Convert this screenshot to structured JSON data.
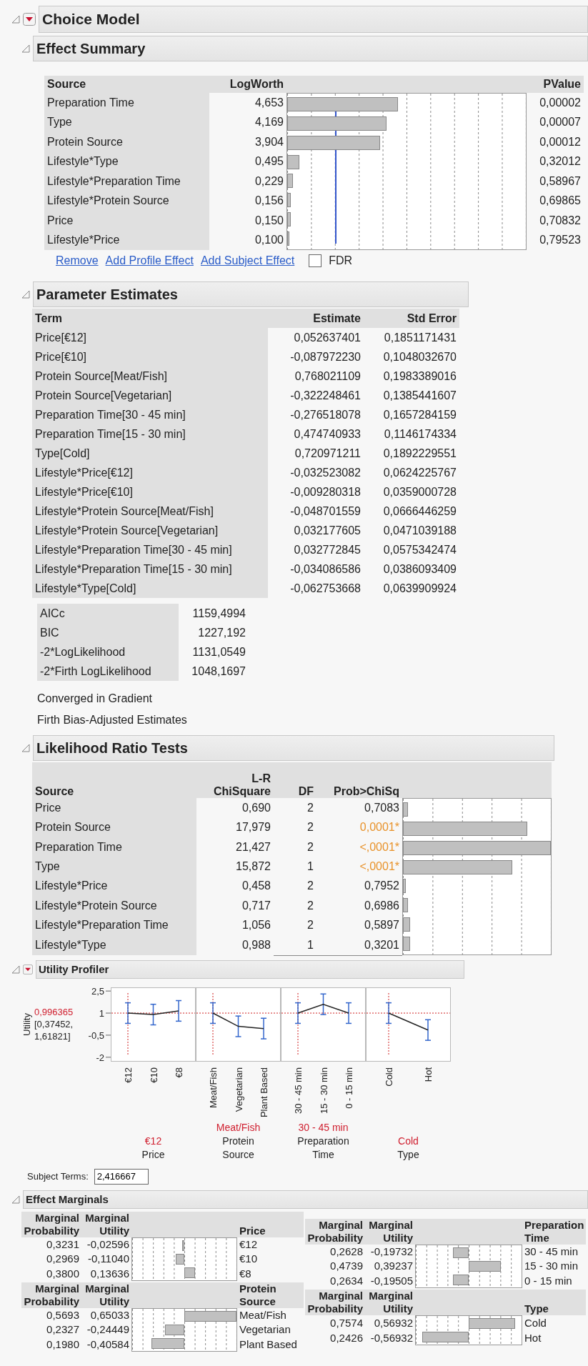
{
  "title": "Choice Model",
  "effect_summary": {
    "title": "Effect Summary",
    "columns": [
      "Source",
      "LogWorth",
      "PValue"
    ],
    "rows": [
      {
        "source": "Preparation Time",
        "logworth": "4,653",
        "pvalue": "0,00002"
      },
      {
        "source": "Type",
        "logworth": "4,169",
        "pvalue": "0,00007"
      },
      {
        "source": "Protein Source",
        "logworth": "3,904",
        "pvalue": "0,00012"
      },
      {
        "source": "Lifestyle*Type",
        "logworth": "0,495",
        "pvalue": "0,32012"
      },
      {
        "source": "Lifestyle*Preparation Time",
        "logworth": "0,229",
        "pvalue": "0,58967"
      },
      {
        "source": "Lifestyle*Protein Source",
        "logworth": "0,156",
        "pvalue": "0,69865"
      },
      {
        "source": "Price",
        "logworth": "0,150",
        "pvalue": "0,70832"
      },
      {
        "source": "Lifestyle*Price",
        "logworth": "0,100",
        "pvalue": "0,79523"
      }
    ],
    "links": [
      "Remove",
      "Add Profile Effect",
      "Add Subject Effect"
    ],
    "fdr": {
      "label": "FDR",
      "checked": false
    }
  },
  "parameter_estimates": {
    "title": "Parameter Estimates",
    "columns": [
      "Term",
      "Estimate",
      "Std Error"
    ],
    "rows": [
      {
        "term": "Price[€12]",
        "estimate": "0,052637401",
        "std_error": "0,1851171431"
      },
      {
        "term": "Price[€10]",
        "estimate": "-0,087972230",
        "std_error": "0,1048032670"
      },
      {
        "term": "Protein Source[Meat/Fish]",
        "estimate": "0,768021109",
        "std_error": "0,1983389016"
      },
      {
        "term": "Protein Source[Vegetarian]",
        "estimate": "-0,322248461",
        "std_error": "0,1385441607"
      },
      {
        "term": "Preparation Time[30 - 45 min]",
        "estimate": "-0,276518078",
        "std_error": "0,1657284159"
      },
      {
        "term": "Preparation Time[15 - 30 min]",
        "estimate": "0,474740933",
        "std_error": "0,1146174334"
      },
      {
        "term": "Type[Cold]",
        "estimate": "0,720971211",
        "std_error": "0,1892229551"
      },
      {
        "term": "Lifestyle*Price[€12]",
        "estimate": "-0,032523082",
        "std_error": "0,0624225767"
      },
      {
        "term": "Lifestyle*Price[€10]",
        "estimate": "-0,009280318",
        "std_error": "0,0359000728"
      },
      {
        "term": "Lifestyle*Protein Source[Meat/Fish]",
        "estimate": "-0,048701559",
        "std_error": "0,0666446259"
      },
      {
        "term": "Lifestyle*Protein Source[Vegetarian]",
        "estimate": "0,032177605",
        "std_error": "0,0471039188"
      },
      {
        "term": "Lifestyle*Preparation Time[30 - 45 min]",
        "estimate": "0,032772845",
        "std_error": "0,0575342474"
      },
      {
        "term": "Lifestyle*Preparation Time[15 - 30 min]",
        "estimate": "-0,034086586",
        "std_error": "0,0386093409"
      },
      {
        "term": "Lifestyle*Type[Cold]",
        "estimate": "-0,062753668",
        "std_error": "0,0639909924"
      }
    ],
    "fit_stats": [
      {
        "label": "AICc",
        "value": "1159,4994"
      },
      {
        "label": "BIC",
        "value": "1227,192"
      },
      {
        "label": "-2*LogLikelihood",
        "value": "1131,0549"
      },
      {
        "label": "-2*Firth LogLikelihood",
        "value": "1048,1697"
      }
    ],
    "notes": [
      "Converged in Gradient",
      "Firth Bias-Adjusted Estimates"
    ]
  },
  "likelihood_ratio_tests": {
    "title": "Likelihood Ratio Tests",
    "columns": [
      "Source",
      "L-R ChiSquare",
      "DF",
      "Prob>ChiSq"
    ],
    "rows": [
      {
        "source": "Price",
        "chisquare": "0,690",
        "df": "2",
        "prob": "0,7083",
        "significant": false
      },
      {
        "source": "Protein Source",
        "chisquare": "17,979",
        "df": "2",
        "prob": "0,0001*",
        "significant": true
      },
      {
        "source": "Preparation Time",
        "chisquare": "21,427",
        "df": "2",
        "prob": "<,0001*",
        "significant": true
      },
      {
        "source": "Type",
        "chisquare": "15,872",
        "df": "1",
        "prob": "<,0001*",
        "significant": true
      },
      {
        "source": "Lifestyle*Price",
        "chisquare": "0,458",
        "df": "2",
        "prob": "0,7952",
        "significant": false
      },
      {
        "source": "Lifestyle*Protein Source",
        "chisquare": "0,717",
        "df": "2",
        "prob": "0,6986",
        "significant": false
      },
      {
        "source": "Lifestyle*Preparation Time",
        "chisquare": "1,056",
        "df": "2",
        "prob": "0,5897",
        "significant": false
      },
      {
        "source": "Lifestyle*Type",
        "chisquare": "0,988",
        "df": "1",
        "prob": "0,3201",
        "significant": false
      }
    ]
  },
  "utility_profiler": {
    "title": "Utility Profiler",
    "ylabel": "Utility",
    "current_value": "0,996365",
    "interval": "[0,37452, 1,61821]",
    "panels": [
      {
        "current": "€12",
        "chart_data": {
          "type": "line",
          "xlabel": "Price",
          "categories": [
            "€12",
            "€10",
            "€8"
          ],
          "values": [
            1.0,
            0.9,
            1.15
          ],
          "ylim": [
            -2.3,
            2.75
          ],
          "yticks": [
            {
              "value": 2.5,
              "label": "2,5"
            },
            {
              "value": 1,
              "label": "1"
            },
            {
              "value": -0.5,
              "label": "-0,5"
            },
            {
              "value": -2,
              "label": "-2"
            }
          ]
        }
      },
      {
        "current": "Meat/Fish",
        "chart_data": {
          "type": "line",
          "xlabel": "Protein Source",
          "categories": [
            "Meat/Fish",
            "Vegetarian",
            "Plant Based"
          ],
          "values": [
            1.0,
            0.1,
            -0.05
          ],
          "ylim": [
            -2.3,
            2.75
          ]
        }
      },
      {
        "current": "30 - 45 min",
        "chart_data": {
          "type": "line",
          "xlabel": "Preparation Time",
          "categories": [
            "30 - 45 min",
            "15 - 30 min",
            "0 - 15 min"
          ],
          "values": [
            1.0,
            1.6,
            1.0
          ],
          "ylim": [
            -2.3,
            2.75
          ]
        }
      },
      {
        "current": "Cold",
        "chart_data": {
          "type": "line",
          "xlabel": "Type",
          "categories": [
            "Cold",
            "Hot"
          ],
          "values": [
            1.0,
            -0.15
          ],
          "ylim": [
            -2.3,
            2.75
          ]
        }
      }
    ],
    "subject_terms": {
      "label": "Subject Terms:",
      "value": "2,416667"
    }
  },
  "effect_marginals": {
    "title": "Effect Marginals",
    "left": [
      {
        "factor": "Price",
        "columns": [
          "Marginal Probability",
          "Marginal Utility"
        ],
        "rows": [
          {
            "probability": "0,3231",
            "utility": "-0,02596",
            "level": "€12"
          },
          {
            "probability": "0,2969",
            "utility": "-0,11040",
            "level": "€10"
          },
          {
            "probability": "0,3800",
            "utility": "0,13636",
            "level": "€8"
          }
        ]
      },
      {
        "factor": "Protein Source",
        "columns": [
          "Marginal Probability",
          "Marginal Utility"
        ],
        "rows": [
          {
            "probability": "0,5693",
            "utility": "0,65033",
            "level": "Meat/Fish"
          },
          {
            "probability": "0,2327",
            "utility": "-0,24449",
            "level": "Vegetarian"
          },
          {
            "probability": "0,1980",
            "utility": "-0,40584",
            "level": "Plant Based"
          }
        ]
      }
    ],
    "right": [
      {
        "factor": "Preparation Time",
        "columns": [
          "Marginal Probability",
          "Marginal Utility"
        ],
        "rows": [
          {
            "probability": "0,2628",
            "utility": "-0,19732",
            "level": "30 - 45 min"
          },
          {
            "probability": "0,4739",
            "utility": "0,39237",
            "level": "15 - 30 min"
          },
          {
            "probability": "0,2634",
            "utility": "-0,19505",
            "level": "0 - 15 min"
          }
        ]
      },
      {
        "factor": "Type",
        "columns": [
          "Marginal Probability",
          "Marginal Utility"
        ],
        "rows": [
          {
            "probability": "0,7574",
            "utility": "0,56932",
            "level": "Cold"
          },
          {
            "probability": "0,2426",
            "utility": "-0,56932",
            "level": "Hot"
          }
        ]
      }
    ]
  }
}
